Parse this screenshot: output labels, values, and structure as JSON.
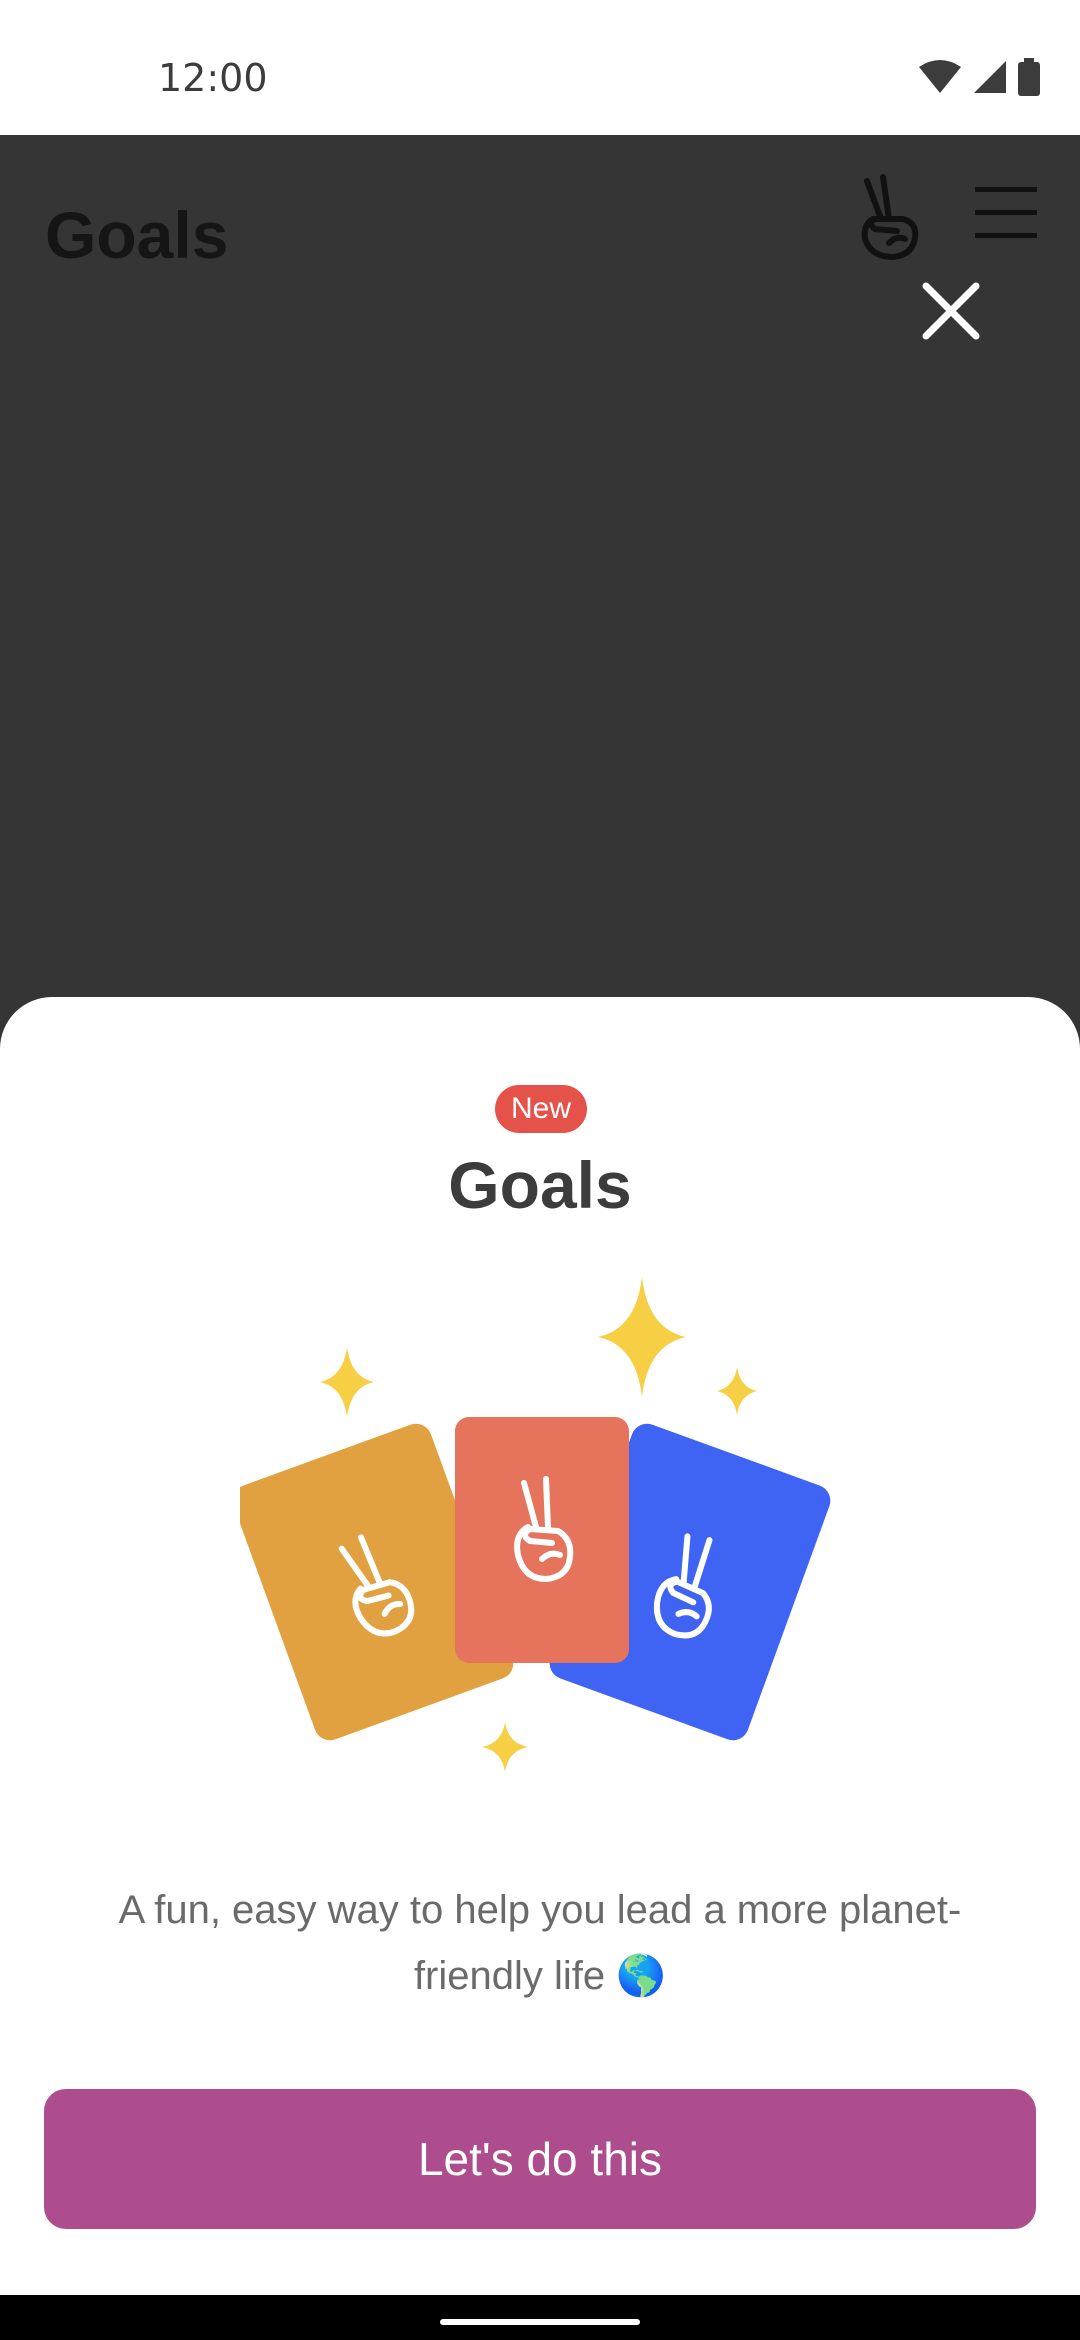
{
  "status_bar": {
    "time": "12:00",
    "icons": [
      "wifi-icon",
      "signal-icon",
      "battery-icon"
    ]
  },
  "header": {
    "title": "Goals",
    "icons": [
      "peace-hand-icon",
      "menu-icon"
    ]
  },
  "dialog": {
    "close_icon": "close-icon",
    "badge": "New",
    "title": "Goals",
    "description": "A fun, easy way to help you lead a more planet-friendly life 🌎",
    "cta_label": "Let's do this",
    "illustration_cards": [
      "orange",
      "red",
      "blue"
    ]
  },
  "colors": {
    "scrim": "#353535",
    "badge": "#e5524a",
    "cta": "#ad4d8d",
    "card_orange": "#e2a141",
    "card_red": "#e6735c",
    "card_blue": "#3f63f3",
    "sparkle": "#f7cf45"
  }
}
